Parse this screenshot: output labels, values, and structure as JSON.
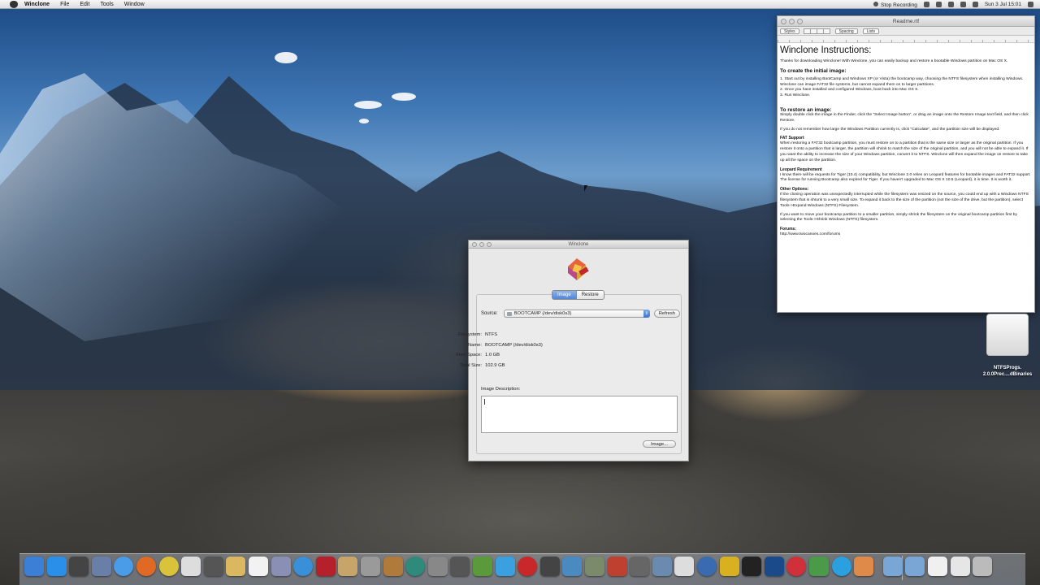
{
  "menubar": {
    "app_name": "Winclone",
    "items": [
      "File",
      "Edit",
      "Tools",
      "Window"
    ],
    "stop_recording": "Stop Recording",
    "clock": "Sun 3 Jul  15:01"
  },
  "readme": {
    "window_title": "Readme.rtf",
    "toolbar": {
      "styles": "Styles",
      "spacing": "Spacing",
      "lists": "Lists"
    },
    "heading": "Winclone Instructions:",
    "intro": "Thanks for downloading Winclone! With Winclone, you can easily backup and restore a bootable Windows partition on Mac OS X.",
    "create_heading": "To create the initial image:",
    "create_step1": "1.  Start out by installing BootCamp and Windows XP (or Vista) the bootcamp way, choosing the NTFS filesystem when installing Windows.  Winclone can image FAT32 file systems, but cannot expand them on to larger partitions.",
    "create_step2": "2.  Once you have installed and configured Windows, boot back into Mac OS X.",
    "create_step3": "3.  Run Winclone.",
    "restore_heading": "To restore an image:",
    "restore_p1": "Simply double click the image in the Finder, click the \"Select Image button\", or drag an image onto the Restore Image text field, and then click Restore.",
    "restore_p2": "If you do not remember how large the Windows Partition currently is, click \"Calculate\", and the partition size will be displayed.",
    "fat32_heading": "FAT Support",
    "fat32_p": "When restoring a FAT32 bootcamp partition, you must restore on to a partition that is the same size or larger as the original partition.  If you restore it onto a partition that is larger, the partition will shrink to match the size of the original partition, and you will not be able to expand it.  If you want the ability to increase the size of your Windows partition, convert it to NTFS. Winclone will then expand the image on restore to take up all the space on the partition.",
    "leopard_heading": "Leopard Requirement",
    "leopard_p": "I know there will be requests for Tiger (10.4) compatibility, but Winclone 2.0 relies on Leopard features for bootable images and FAT32 support.  The license for running Bootcamp also expired for Tiger.  If you haven't upgraded to Mac OS X 10.5 (Leopard), it is time.  It is worth it.",
    "other_heading": "Other Options:",
    "other_p1": "If the cloning operation was unexpectedly interrupted while the filesystem was resized on the source, you could end up with a Windows NTFS filesystem that is shrunk to a very small size.  To expand it back to the size of the partition (not the size of the drive, but the partition), select Tools->Expand Windows (NTFS) Filesystem.",
    "other_p2": "If you want to move your bootcamp partition to a smaller partition, simply shrink the filesystem on the original bootcamp partition first by selecting the Tools->Shrink Windows (NTFS) filesystem.",
    "forums_heading": "Forums:",
    "forums_url": "http://www.twocanoes.com/forums"
  },
  "winclone": {
    "window_title": "Winclone",
    "tabs": [
      "Image",
      "Restore"
    ],
    "source_label": "Source:",
    "source_value": "BOOTCAMP (/dev/disk0s3)",
    "refresh_label": "Refresh",
    "info": [
      {
        "label": "Filesystem:",
        "value": "NTFS"
      },
      {
        "label": "Name:",
        "value": "BOOTCAMP (/dev/disk0s3)"
      },
      {
        "label": "Free Space:",
        "value": "1.0 GB"
      },
      {
        "label": "Total Size:",
        "value": "102.9 GB"
      }
    ],
    "image_description_label": "Image Description:",
    "image_button": "Image..."
  },
  "desktop": {
    "drive_label_line1": "NTFSProgs.",
    "drive_label_line2": "2.0.0Prec....dBinaries"
  },
  "dock": {
    "icons": [
      {
        "name": "finder",
        "color": "#3c7fd6"
      },
      {
        "name": "app-store",
        "color": "#2a8fe8"
      },
      {
        "name": "dashboard",
        "color": "#444"
      },
      {
        "name": "preview",
        "color": "#6a7fa8"
      },
      {
        "name": "safari",
        "color": "#4a9be8"
      },
      {
        "name": "firefox",
        "color": "#e06a24"
      },
      {
        "name": "chrome",
        "color": "#d9c33a"
      },
      {
        "name": "mouse",
        "color": "#ddd"
      },
      {
        "name": "camera",
        "color": "#555"
      },
      {
        "name": "notes",
        "color": "#d9b860"
      },
      {
        "name": "calendar",
        "color": "#f2f2f2"
      },
      {
        "name": "photo-tool",
        "color": "#8a8fb5"
      },
      {
        "name": "itunes",
        "color": "#3a8fd9"
      },
      {
        "name": "red-app",
        "color": "#b5202a"
      },
      {
        "name": "iphoto",
        "color": "#c6a46a"
      },
      {
        "name": "star-tool",
        "color": "#9a9a9a"
      },
      {
        "name": "guitar",
        "color": "#b07a3a"
      },
      {
        "name": "time-machine",
        "color": "#2e8a7a"
      },
      {
        "name": "system-preferences",
        "color": "#888"
      },
      {
        "name": "screen",
        "color": "#555"
      },
      {
        "name": "minecraft",
        "color": "#5a9a3a"
      },
      {
        "name": "twitter",
        "color": "#3aa0e0"
      },
      {
        "name": "red-round-app",
        "color": "#c8282a"
      },
      {
        "name": "tool",
        "color": "#444"
      },
      {
        "name": "network",
        "color": "#4a8ac0"
      },
      {
        "name": "game",
        "color": "#7a8a6a"
      },
      {
        "name": "character",
        "color": "#c04030"
      },
      {
        "name": "gears",
        "color": "#666"
      },
      {
        "name": "picture",
        "color": "#6a8ab0"
      },
      {
        "name": "pen",
        "color": "#ddd"
      },
      {
        "name": "globe",
        "color": "#3a6ab0"
      },
      {
        "name": "fireworks",
        "color": "#d9b020"
      },
      {
        "name": "terminal",
        "color": "#222"
      },
      {
        "name": "photoshop",
        "color": "#1a4a8a"
      },
      {
        "name": "toad",
        "color": "#d0303a"
      },
      {
        "name": "plant",
        "color": "#4a9a4a"
      },
      {
        "name": "skype",
        "color": "#2aa0e0"
      },
      {
        "name": "crayons",
        "color": "#e08a4a"
      },
      {
        "name": "folder-a",
        "color": "#7aa6d6"
      },
      {
        "name": "folder-b",
        "color": "#7aa6d6"
      },
      {
        "name": "document",
        "color": "#f0f0f0"
      },
      {
        "name": "drive",
        "color": "#e6e6e6"
      },
      {
        "name": "trash",
        "color": "#bbb"
      }
    ]
  }
}
